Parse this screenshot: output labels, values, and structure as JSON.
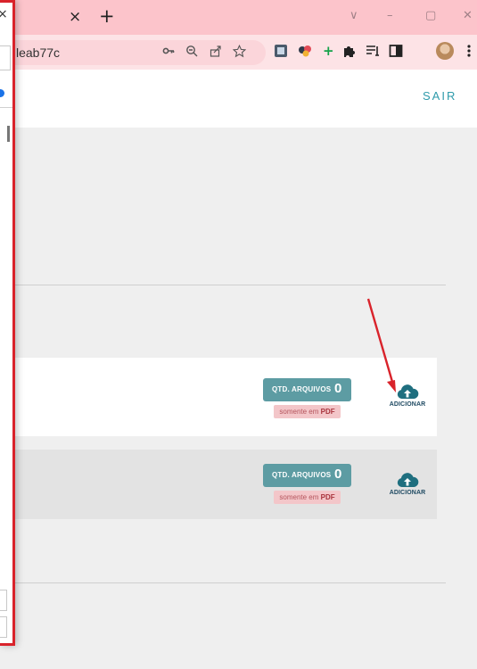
{
  "browser": {
    "tab_close_glyph": "×",
    "new_tab_glyph": "+",
    "window_controls": [
      "∨",
      "–",
      "▢",
      "✕"
    ],
    "url_text": "leab77c",
    "omnibox_icons": [
      "key-icon",
      "zoom-icon",
      "share-icon",
      "star-icon"
    ],
    "extension_icons": [
      "ext-docs-icon",
      "ext-palette-icon",
      "ext-plus-icon",
      "puzzle-icon",
      "reading-list-icon",
      "side-panel-icon",
      "profile-avatar",
      "menu-icon"
    ]
  },
  "header": {
    "logout_label": "SAIR"
  },
  "uploads": [
    {
      "qtd_label": "QTD. ARQUIVOS",
      "qtd_value": "0",
      "pdf_prefix": "somente em ",
      "pdf_ext": "PDF",
      "add_label": "ADICIONAR"
    },
    {
      "qtd_label": "QTD. ARQUIVOS",
      "qtd_value": "0",
      "pdf_prefix": "somente em ",
      "pdf_ext": "PDF",
      "add_label": "ADICIONAR"
    }
  ],
  "popup": {
    "close_glyph": "×"
  },
  "colors": {
    "tab_bar": "#fcc4cb",
    "toolbar": "#fde3e6",
    "accent": "#2f9bab",
    "badge": "#5d9ca3",
    "cloud_icon": "#1f6f7f",
    "annotation_red": "#d9232b"
  }
}
